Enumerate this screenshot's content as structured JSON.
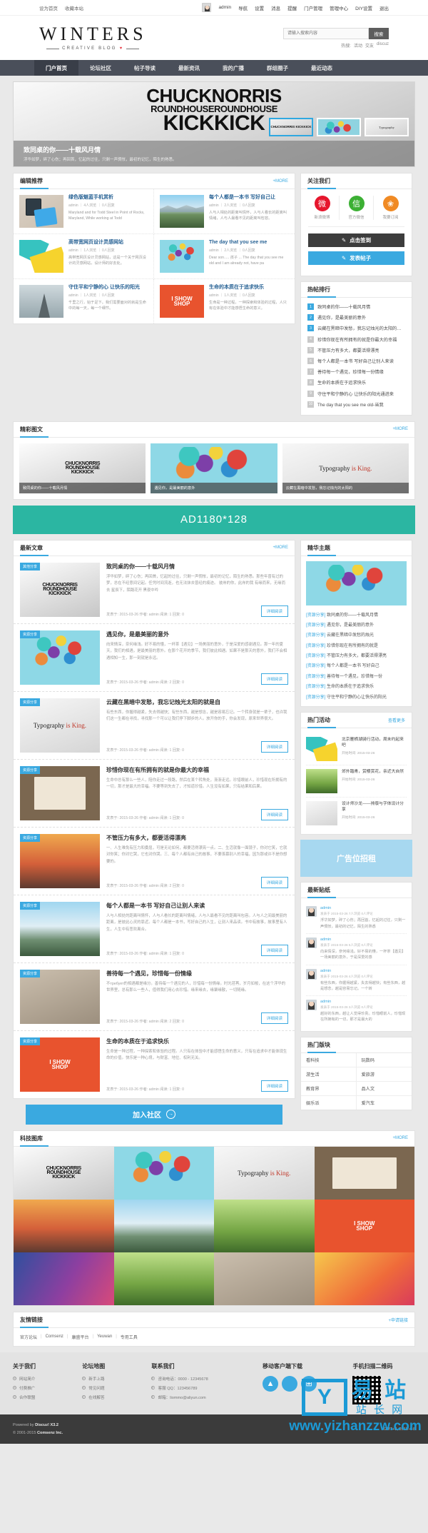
{
  "topbar": {
    "left": [
      "设为首页",
      "收藏本站"
    ],
    "right": [
      "admin",
      "导航",
      "设置",
      "消息",
      "提醒",
      "门户管理",
      "管理中心",
      "DIY设置",
      "退出"
    ],
    "avatar_icon": "user-avatar-icon"
  },
  "logo": {
    "main": "WINTERS",
    "sub": "CREATIVE BLOG",
    "heart": "♥",
    "rule": "——"
  },
  "search": {
    "placeholder": "请输入搜索内容",
    "button": "搜索",
    "hot_label": "热搜:",
    "hot_words": [
      "活动",
      "交友",
      "discuz"
    ]
  },
  "nav": {
    "items": [
      "门户首页",
      "论坛社区",
      "帖子导读",
      "最新资讯",
      "我的广播",
      "群组圈子",
      "最近动态"
    ],
    "active_index": 0
  },
  "slider": {
    "art_line1": "CHUCKNORRIS",
    "art_line2": "ROUNDHOUSEROUNDHOUSE",
    "art_line3": "KICKKICK",
    "title": "致同桌的你——十载风月情",
    "desc": "浮华如梦，碎了心伤；再回首，忆起的过往，只剩一声惆怅，最初的记忆，陌生的熟悉。",
    "thumbs": [
      {
        "name": "chuck-thumb",
        "text": "CHUCKNORRIS KICKKICK",
        "active": true
      },
      {
        "name": "balloon-thumb",
        "text": "",
        "active": false
      },
      {
        "name": "typography-thumb",
        "text": "Typography",
        "active": false
      }
    ]
  },
  "editor_recommend": {
    "title": "编辑推荐",
    "more": "+MORE",
    "items": [
      {
        "art": "art-phone",
        "title": "绿色版魅蓝手机赏析",
        "meta": "admin ｜ 4人浏览 ｜ 0人回复",
        "desc": "Maryland and for Todd Steel in Point of Rocks, Maryland, While working at Todd"
      },
      {
        "art": "art-lake",
        "title": "每个人都是一本书 写好自己让",
        "meta": "admin ｜ 2人浏览 ｜ 0人回复",
        "desc": "人与人相处的距离叫情怀，人与人看长的距离叫情绪，人与人最看不见的距离叫包容。"
      },
      {
        "art": "art-geom",
        "title": "高带宽网页设计灵感网站",
        "meta": "admin ｜ 1人浏览 ｜ 0人回复",
        "desc": "高带宽网页设计灵感网站，这是一个关于网页设计的灵感网站，设计师的好去处。"
      },
      {
        "art": "art-balloon",
        "title": "The day that you see me",
        "meta": "admin ｜ 2人浏览 ｜ 0人回复",
        "desc": "Dear son..... 孩子 ... The day that you see me old and I am already not, have pa"
      },
      {
        "art": "art-tower",
        "title": "守住平和宁静的心 让快乐的阳光",
        "meta": "admin ｜ 1人浏览 ｜ 0人回复",
        "desc": "千里之行，始于足下。我们需要面对的就是生命中的每一天，每一个细节。"
      },
      {
        "art": "art-shop",
        "title": "生命的本质在于追求快乐",
        "meta": "admin ｜ 1人浏览 ｜ 0人回复",
        "desc": "生命是一种过程，一种探索和体验的过程，人只有在体验中才能感悟生命的意义。"
      }
    ]
  },
  "follow": {
    "title": "关注我们",
    "socials": [
      {
        "icon": "weibo-icon",
        "glyph": "微",
        "label": "新浪微博",
        "color": "#e6162d"
      },
      {
        "icon": "wechat-icon",
        "glyph": "信",
        "label": "官方微信",
        "color": "#3cb034"
      },
      {
        "icon": "rss-icon",
        "glyph": "❀",
        "label": "我要订阅",
        "color": "#f08a24"
      }
    ],
    "btn_signin": "点击签到",
    "btn_signin_icon": "signin-pen-icon",
    "btn_post": "发表帖子",
    "btn_post_icon": "compose-pen-icon"
  },
  "hot_rank": {
    "title": "热帖排行",
    "items": [
      "致同桌的你——十载风月情",
      "遇见你，是最美丽的意外",
      "云藏在黑暗中发愁，我忘记烛光的太阳的就是自",
      "珍惜你现在有所拥有的就是你最大的幸福",
      "不管压力有多大，都要活得漂亮",
      "每个人都是一本书 写好自己让别人来读",
      "善待每一个遇见，珍惜每一份情缘",
      "生命的本质在于追求快乐",
      "守住平和宁静的心 让快乐的阳光通进来",
      "The day that you see me old-当我"
    ]
  },
  "pic_text": {
    "title": "精彩图文",
    "more": "+MORE",
    "items": [
      {
        "art": "art-chuck",
        "caption": "致同桌的你——十载风月情"
      },
      {
        "art": "art-balloon",
        "caption": "遇见你，是最美丽的意外"
      },
      {
        "art": "art-type",
        "caption": "云藏在黑暗中发愁，我忘记烛光的太阳的"
      }
    ]
  },
  "ad_banner": {
    "text": "AD1180*128"
  },
  "articles": {
    "title": "最新文章",
    "more": "+MORE",
    "items": [
      {
        "art": "art-chuck",
        "tag": "其他分享",
        "title": "致同桌的你——十载风月情",
        "summary": "浮华如梦，碎了心伤；再回首，忆起的过往，只剩一声惆怅，最初的记忆，陌生的熟悉。那些年曾有过的梦，总在不经意间记起。任凭时间流逝，也无法抹去曾经的痕迹。 彼岸的你，此岸的我 有缘而来，无缘而去 星辰下，陌路花开 黑夜中吟",
        "meta": "发表于: 2015-03-26  作者: admin  阅读: 1  回复: 0",
        "btn": "详细阅读"
      },
      {
        "art": "art-balloon",
        "tag": "资源分享",
        "title": "遇见你，是最美丽的意外",
        "summary": "向来情深，奈何缘浅。好不易的懂，一杯茶【遇见】一场美丽的意外，于是深爱的感谢遇见。那一年的夏天，我们的相遇，是最美丽的意外。在那个花开的季节，我们彼此相遇。如果不是那天的意外，我们不会相遇相知一生，那一刻就是永远。",
        "meta": "发表于: 2015-03-26  作者: admin  阅读: 2  回复: 0",
        "btn": "详细阅读"
      },
      {
        "art": "art-type",
        "tag": "资源分享",
        "title": "云藏在黑暗中发愁，我忘记烛光太阳的就是自",
        "summary": "有些东西，你握得越紧，失去得越快；有些东西，越是想念，越是容易忘记。一个转身就是一辈子，也许我们这一生都在寻找，寻找那一个可以让我们停下脚步的人。放开你的手，你会发现，原来世界很大。",
        "meta": "发表于: 2015-03-26  作者: admin  阅读: 1  回复: 0",
        "btn": "详细阅读"
      },
      {
        "art": "art-book",
        "tag": "资源分享",
        "title": "珍惜你现在有所拥有的就是你最大的幸福",
        "summary": "生命中总有那么一些人，陪你走过一段路，然后在某个转角处，渐渐走远。珍惜眼前人，珍惜现在所拥有的一切，那才是最大的幸福。不要等到失去了，才知道珍惜。人生没有如果，只有结果和后果。",
        "meta": "发表于: 2015-03-26  作者: admin  阅读: 1  回复: 0",
        "btn": "详细阅读"
      },
      {
        "art": "art-surf",
        "tag": "资源分享",
        "title": "不管压力有多大，都要活得漂亮",
        "summary": "一、人生难免有压力和委屈，可是无论如何，都要活得漂亮一点。二、生活就像一面镜子，你对它笑，它就对你笑；你对它哭，它也对你哭。三、每个人都有自己的故事，不要羡慕别人的幸福，因为那或许不是你想要的。",
        "meta": "发表于: 2015-03-26  作者: admin  阅读: 2  回复: 0",
        "btn": "详细阅读"
      },
      {
        "art": "art-mount",
        "tag": "资源分享",
        "title": "每个人都是一本书 写好自己让别人来读",
        "summary": "人与人相处的距离叫情怀，人与人看长的距离叫情绪，人与人最看不见的距离叫包容。人与人之间最美丽的距离，是彼此心灵的靠近。每个人都是一本书，写好自己的人生，让别人来品读。书中有故事，故事里有人生，人生中有悲欢离合。",
        "meta": "发表于: 2015-03-26  作者: admin  阅读: 1  回复: 0",
        "btn": "详细阅读"
      },
      {
        "art": "art-wall",
        "tag": "资源分享",
        "title": "善待每一个遇见，珍惜每一份情缘",
        "summary": "不требует的相遇都是缘分。善待每一个遇见的人，珍惜每一份情缘。时光荏苒，岁月如梭，在这个浮华的世界里，总有那么一些人，值得我们用心去珍惜。缘来缘去，缘聚缘散，一切随缘。",
        "meta": "发表于: 2015-03-26  作者: admin  阅读: 2  回复: 0",
        "btn": "详细阅读"
      },
      {
        "art": "art-shop",
        "tag": "资源分享",
        "title": "生命的本质在于追求快乐",
        "summary": "生命是一种过程，一种探索和体验的过程。人只有在体验中才能感悟生命的意义，只有在追求中才能体现生命的价值。快乐是一种心境，与财富、地位、权利无关。",
        "meta": "发表于: 2015-03-26  作者: admin  阅读: 1  回复: 0",
        "btn": "详细阅读"
      }
    ]
  },
  "join": {
    "text": "加入社区",
    "arrow": "→"
  },
  "essence": {
    "title": "精华主题",
    "pic_art": "art-balloon",
    "items": [
      {
        "tag": "[资源分享]",
        "text": "致同桌的你——十载风月情"
      },
      {
        "tag": "[资源分享]",
        "text": "遇见你，是最美丽的意外"
      },
      {
        "tag": "[资源分享]",
        "text": "云藏在黑暗中发愁的烛光"
      },
      {
        "tag": "[资源分享]",
        "text": "珍惜你现在有所拥有的就是"
      },
      {
        "tag": "[资源分享]",
        "text": "不管压力有多大，都要活得漂亮"
      },
      {
        "tag": "[资源分享]",
        "text": "每个人都是一本书 写好自己"
      },
      {
        "tag": "[资源分享]",
        "text": "善待每一个遇见，珍惜每一份"
      },
      {
        "tag": "[资源分享]",
        "text": "生命的本质在于追求快乐"
      },
      {
        "tag": "[资源分享]",
        "text": "守住平和宁静的心让快乐的阳光"
      }
    ]
  },
  "hot_activity": {
    "title": "热门活动",
    "more": "查看更多",
    "items": [
      {
        "art": "art-geom",
        "title": "北京雁栖湖骑行活动，周末约起来吧",
        "date": "开始时间: 2015-03-26"
      },
      {
        "art": "art-grass",
        "title": "郊外踏青，赏樱赏花，亲近大自然",
        "date": "开始时间: 2015-03-26"
      },
      {
        "art": "art-type",
        "title": "设计师沙龙——排版与字体设计分享",
        "date": "开始时间: 2015-03-26"
      }
    ]
  },
  "side_ad": {
    "text": "广告位招租"
  },
  "newest_posts": {
    "title": "最新贴纸",
    "items": [
      {
        "name": "admin",
        "date": "发表于 2015-03-26  7人浏览  0人评论",
        "text": "浮华如梦，碎了心伤；再回首，忆起的过往，只剩一声惆怅，最初的记忆，陌生的熟悉"
      },
      {
        "name": "admin",
        "date": "发表于 2015-03-26  5人浏览  0人评论",
        "text": "向来情深，奈何缘浅。好不易的懂，一杯茶【遇见】一场美丽的意外，于是深爱的感"
      },
      {
        "name": "admin",
        "date": "发表于 2015-03-26  4人浏览  0人评论",
        "text": "有些东西，你握得越紧，失去得越快；有些东西，越是想念，越是容易忘记。一个转"
      },
      {
        "name": "admin",
        "date": "发表于 2015-03-26  3人浏览  0人评论",
        "text": "越好的东西，越让人觉得珍贵。珍惜眼前人，珍惜现在所拥有的一切，那才是最大的"
      }
    ]
  },
  "hot_sections": {
    "title": "热门版块",
    "items": [
      "看科技",
      "玩数码",
      "游生活",
      "爱旅游",
      "教育界",
      "品人文",
      "娱乐派",
      "爱汽车"
    ]
  },
  "tech_gallery": {
    "title": "科技图库",
    "more": "+MORE",
    "items": [
      "art-chuck",
      "art-balloon",
      "art-type",
      "art-book",
      "art-surf",
      "art-mount",
      "art-grass",
      "art-shop",
      "art-purple",
      "art-grass",
      "art-wall",
      "art-cloth"
    ]
  },
  "friend_links": {
    "title": "友情链接",
    "apply": "+申请链接",
    "links": [
      "官方论坛",
      "Comsenz",
      "康盛平台",
      "Yeuwan",
      "专用工具"
    ]
  },
  "footer": {
    "columns": [
      {
        "title": "关于我们",
        "items": [
          "网站简介",
          "付费推广",
          "合作联盟"
        ]
      },
      {
        "title": "论坛地图",
        "items": [
          "新手上路",
          "常见问题",
          "在线解答"
        ]
      },
      {
        "title": "联系我们",
        "items": [
          "咨询电话：0000 - 12345678",
          "客服 QQ：123456789",
          "邮箱：liommo@aliyun.com"
        ]
      }
    ],
    "apps_title": "移动客户端下载",
    "apps": [
      {
        "icon": "android-icon",
        "glyph": "▲"
      },
      {
        "icon": "apple-icon",
        "glyph": ""
      },
      {
        "icon": "windows-icon",
        "glyph": "⊞"
      }
    ],
    "qr_title": "手机扫描二维码",
    "powered_prefix": "Powered by ",
    "powered_name": "Discuz! X3.2",
    "copyright_prefix": "© 2001-2015 ",
    "copyright_name": "Comsenz Inc.",
    "gmt": "GMT+8, 2015-4-8"
  },
  "watermark": {
    "y": "Y",
    "cn_top": "易 站",
    "cn_bottom": "站 长 网",
    "url": "www.yizhanzzw.com"
  }
}
